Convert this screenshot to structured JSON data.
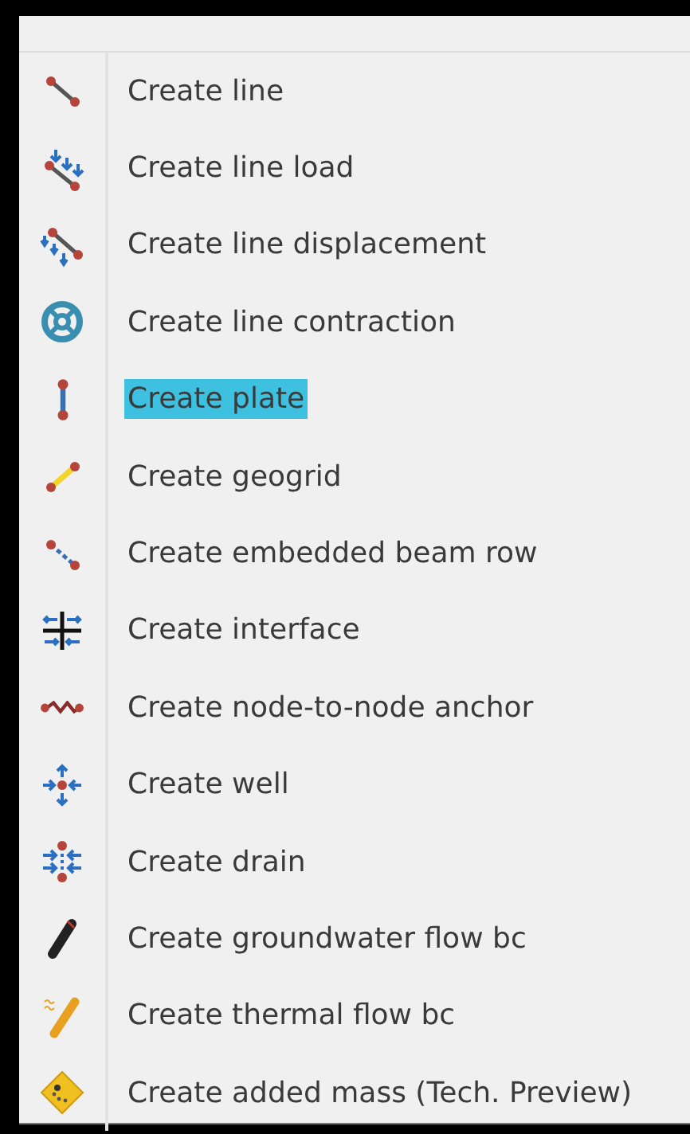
{
  "menu": {
    "items": [
      {
        "label": "Create line",
        "highlighted": false
      },
      {
        "label": "Create line load",
        "highlighted": false
      },
      {
        "label": "Create line displacement",
        "highlighted": false
      },
      {
        "label": "Create line contraction",
        "highlighted": false
      },
      {
        "label": "Create plate",
        "highlighted": true
      },
      {
        "label": "Create geogrid",
        "highlighted": false
      },
      {
        "label": "Create embedded beam row",
        "highlighted": false
      },
      {
        "label": "Create interface",
        "highlighted": false
      },
      {
        "label": "Create node-to-node anchor",
        "highlighted": false
      },
      {
        "label": "Create well",
        "highlighted": false
      },
      {
        "label": "Create drain",
        "highlighted": false
      },
      {
        "label": "Create groundwater flow bc",
        "highlighted": false
      },
      {
        "label": "Create thermal flow bc",
        "highlighted": false
      },
      {
        "label": "Create added mass (Tech. Preview)",
        "highlighted": false
      }
    ]
  }
}
